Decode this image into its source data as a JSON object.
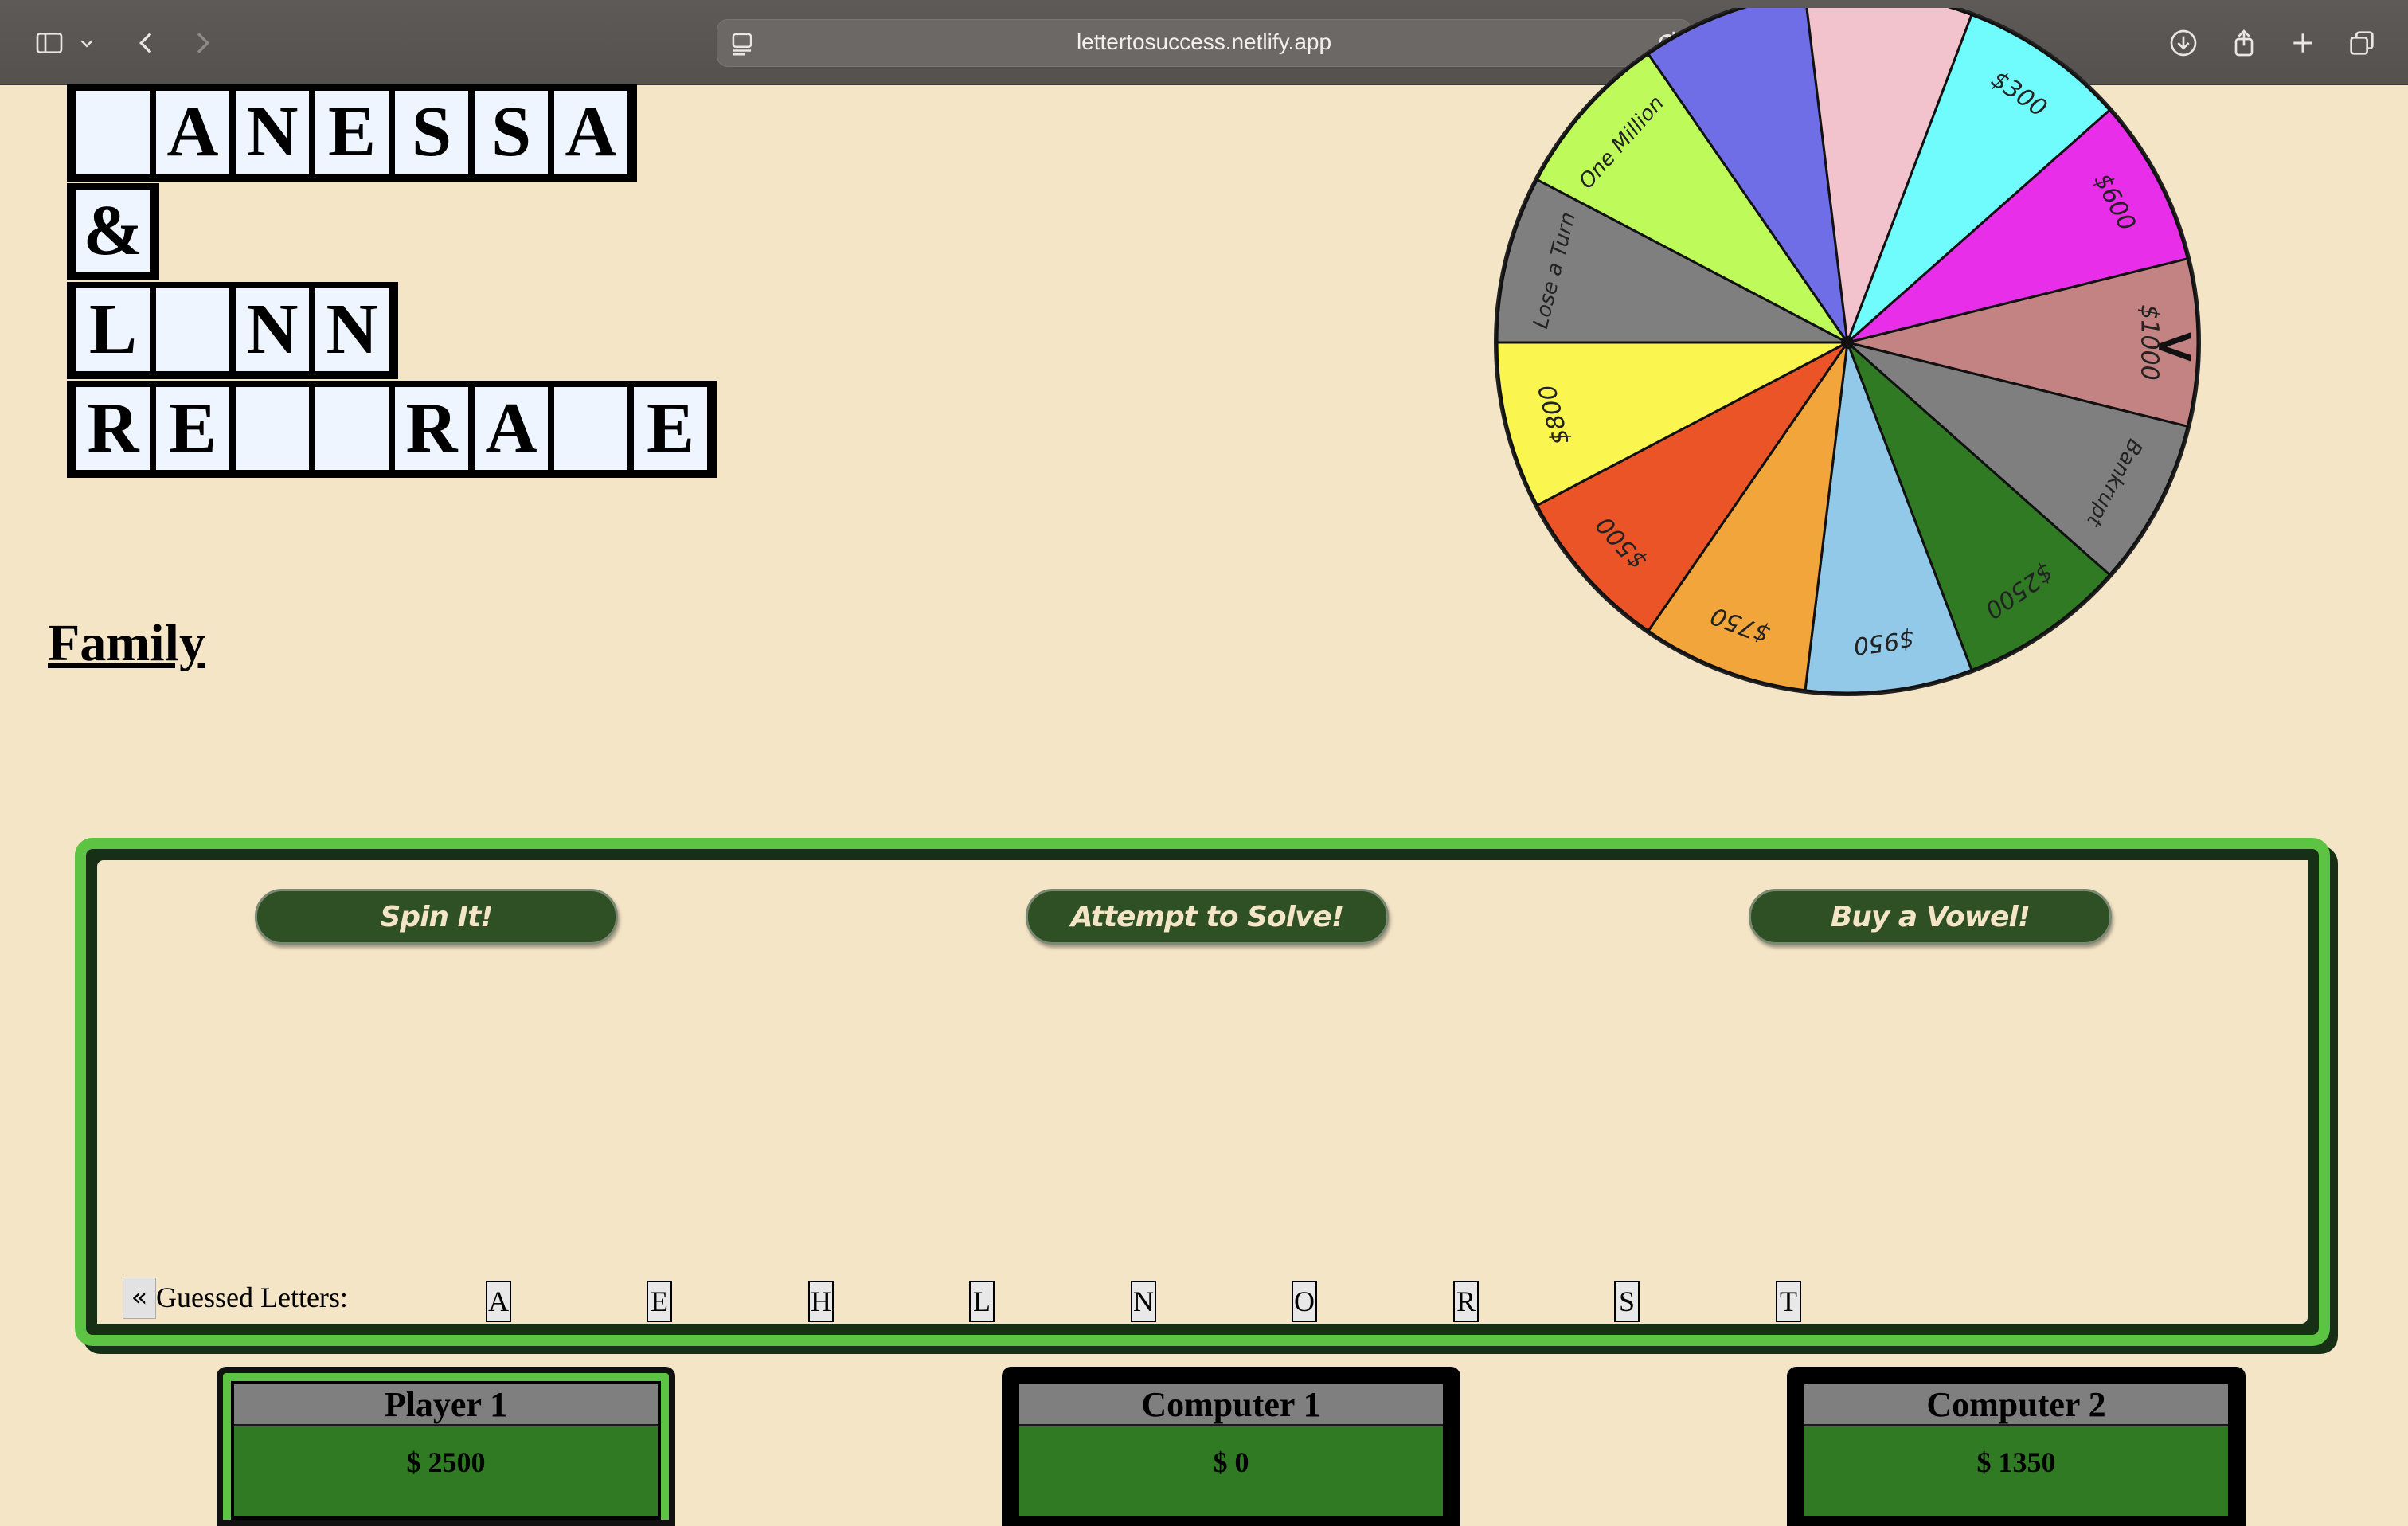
{
  "browser": {
    "url": "lettertosuccess.netlify.app"
  },
  "puzzle": {
    "rows": [
      [
        "",
        "A",
        "N",
        "E",
        "S",
        "S",
        "A"
      ],
      [
        "&"
      ],
      [
        "L",
        "",
        "N",
        "N"
      ],
      [
        "R",
        "E",
        "",
        "",
        "R",
        "A",
        "",
        "E"
      ]
    ],
    "category": "Family"
  },
  "wheel": {
    "segments": [
      {
        "label": "$1000",
        "color": "#c38383"
      },
      {
        "label": "Bankrupt",
        "color": "#7f7f7f"
      },
      {
        "label": "$2500",
        "color": "#2f7a23"
      },
      {
        "label": "$950",
        "color": "#92c9e8"
      },
      {
        "label": "$750",
        "color": "#f1a53b"
      },
      {
        "label": "$500",
        "color": "#ea5427"
      },
      {
        "label": "$800",
        "color": "#fbf64f"
      },
      {
        "label": "Lose a Turn",
        "color": "#7f7f7f"
      },
      {
        "label": "One Million",
        "color": "#bdfa5a"
      },
      {
        "label": "",
        "color": "#6f6ee6"
      },
      {
        "label": "",
        "color": "#f2c2cd"
      },
      {
        "label": "$300",
        "color": "#70fcfd"
      },
      {
        "label": "$600",
        "color": "#e82ee8"
      }
    ],
    "pointer": "<"
  },
  "controls": {
    "spin_label": "Spin It!",
    "solve_label": "Attempt to Solve!",
    "vowel_label": "Buy a Vowel!"
  },
  "guessed": {
    "collapse_label": "«",
    "label": "Guessed Letters:",
    "letters": [
      "A",
      "E",
      "H",
      "L",
      "N",
      "O",
      "R",
      "S",
      "T"
    ]
  },
  "players": [
    {
      "name": "Player 1",
      "score": "$ 2500"
    },
    {
      "name": "Computer 1",
      "score": "$ 0"
    },
    {
      "name": "Computer 2",
      "score": "$ 1350"
    }
  ],
  "colors": {
    "background": "#f4e5c6",
    "panel_border": "#5dc443",
    "button": "#2f4f25",
    "score_green": "#2f7a23"
  }
}
